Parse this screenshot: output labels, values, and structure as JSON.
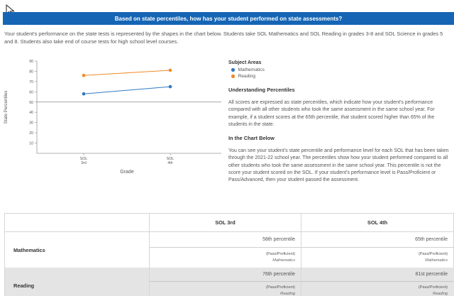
{
  "banner": {
    "title": "Based on state percentiles, how has your student performed on state assessments?"
  },
  "intro": "Your student's performance on the state tests is represented by the shapes in the chart below. Students take SOL Mathematics and SOL Reading in grades 3-8 and SOL Science in grades 5 and 8. Students also take end of course tests for high school level courses.",
  "legend": {
    "title": "Subject Areas",
    "items": [
      {
        "label": "Mathematics",
        "color": "#2f78c4"
      },
      {
        "label": "Reading",
        "color": "#f08a24"
      }
    ]
  },
  "understanding": {
    "title": "Understanding Percentiles",
    "text": "All scores are expressed as state percentiles, which indicate how your student's performance compared with all other students who took the same assessment in the same school year. For example, if a student scores at the 65th percentile, that student scored higher than 65% of the students in the state."
  },
  "in_chart": {
    "title": "In the Chart Below",
    "text": "You can see your student's state percentile and performance level for each SOL that has been taken through the 2021-22 school year. The percentiles show how your student performed compared to all other students who took the same assessment in the same school year. This percentile is not the score your student scored on the SOL. If your student's performance level is Pass/Proficient or Pass/Advanced, then your student passed the assessment."
  },
  "chart_data": {
    "type": "line",
    "categories": [
      [
        "SOL",
        "3rd"
      ],
      [
        "SOL",
        "4th"
      ]
    ],
    "series": [
      {
        "name": "Mathematics",
        "color": "#2f78c4",
        "values": [
          58,
          65
        ]
      },
      {
        "name": "Reading",
        "color": "#f08a24",
        "values": [
          76,
          81
        ]
      }
    ],
    "xlabel": "Grade",
    "ylabel": "State Percentiles",
    "ylim": [
      0,
      90
    ],
    "yticks": [
      10,
      20,
      30,
      40,
      50,
      60,
      70,
      80,
      90
    ],
    "reference_line": 50,
    "grid": false
  },
  "table": {
    "headers": [
      "",
      "SOL 3rd",
      "SOL 4th"
    ],
    "rows": [
      {
        "subject": "Mathematics",
        "cells": [
          {
            "percentile": "58th percentile",
            "level": "(Pass/Proficient)",
            "subject": "Mathematics"
          },
          {
            "percentile": "65th percentile",
            "level": "(Pass/Proficient)",
            "subject": "Mathematics"
          }
        ]
      },
      {
        "subject": "Reading",
        "cells": [
          {
            "percentile": "76th percentile",
            "level": "(Pass/Proficient)",
            "subject": "Reading"
          },
          {
            "percentile": "81st percentile",
            "level": "(Pass/Proficient)",
            "subject": "Reading"
          }
        ]
      }
    ]
  }
}
